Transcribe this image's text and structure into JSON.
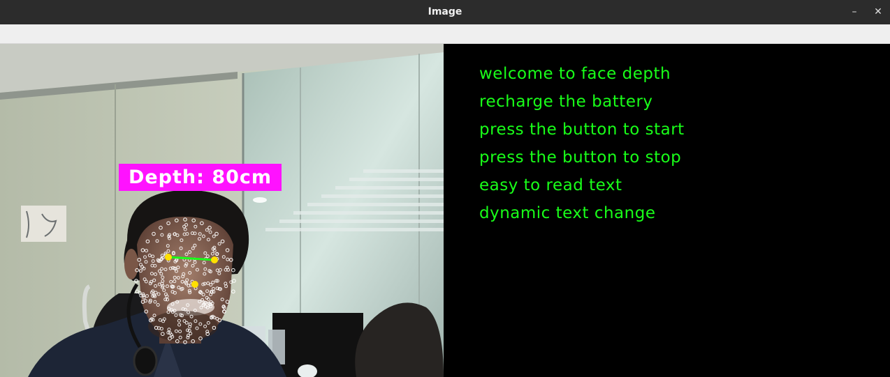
{
  "window": {
    "title": "Image",
    "minimize_glyph": "–",
    "close_glyph": "✕"
  },
  "overlay": {
    "depth_label": "Depth: 80cm",
    "label_color": "#ff12ff",
    "landmark_color": "#ffffff",
    "keypoint_color": "#ffe000",
    "eye_line_color": "#19ff19"
  },
  "info_panel": {
    "text_color": "#19ff19",
    "lines": [
      "welcome to face depth",
      "recharge the battery",
      "press the button to start",
      "press the button to stop",
      "easy to read text",
      "dynamic text change"
    ]
  }
}
